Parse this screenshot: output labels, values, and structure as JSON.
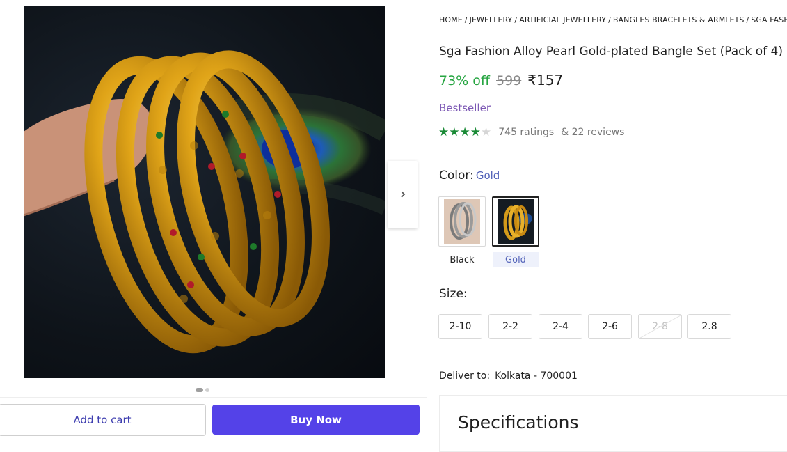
{
  "breadcrumb": [
    "HOME",
    "JEWELLERY",
    "ARTIFICIAL JEWELLERY",
    "BANGLES BRACELETS & ARMLETS",
    "SGA FASHI"
  ],
  "breadcrumb_sep": "/",
  "product": {
    "title": "Sga Fashion Alloy Pearl Gold-plated Bangle Set (Pack of 4)",
    "discount": "73% off",
    "mrp": "599",
    "price": "₹157",
    "badge": "Bestseller",
    "rating_stars": 4,
    "rating_max": 5,
    "ratings_text": "745 ratings",
    "reviews_text": "& 22 reviews"
  },
  "color": {
    "label": "Color:",
    "selected": "Gold",
    "options": [
      {
        "label": "Black"
      },
      {
        "label": "Gold"
      }
    ]
  },
  "size": {
    "label": "Size:",
    "options": [
      "2-10",
      "2-2",
      "2-4",
      "2-6",
      "2-8",
      "2.8"
    ],
    "unavailable": [
      "2-8"
    ]
  },
  "delivery": {
    "label": "Deliver to:",
    "location": "Kolkata - 700001"
  },
  "specifications": {
    "title": "Specifications"
  },
  "actions": {
    "add_to_cart": "Add to cart",
    "buy_now": "Buy Now"
  },
  "icons": {
    "next": "chevron-right-icon",
    "star": "star-icon"
  },
  "colors": {
    "accent": "#5442e8",
    "discount": "#26a541",
    "bestseller": "#7c58b4",
    "star": "#1a8a36",
    "link": "#5161b8"
  }
}
